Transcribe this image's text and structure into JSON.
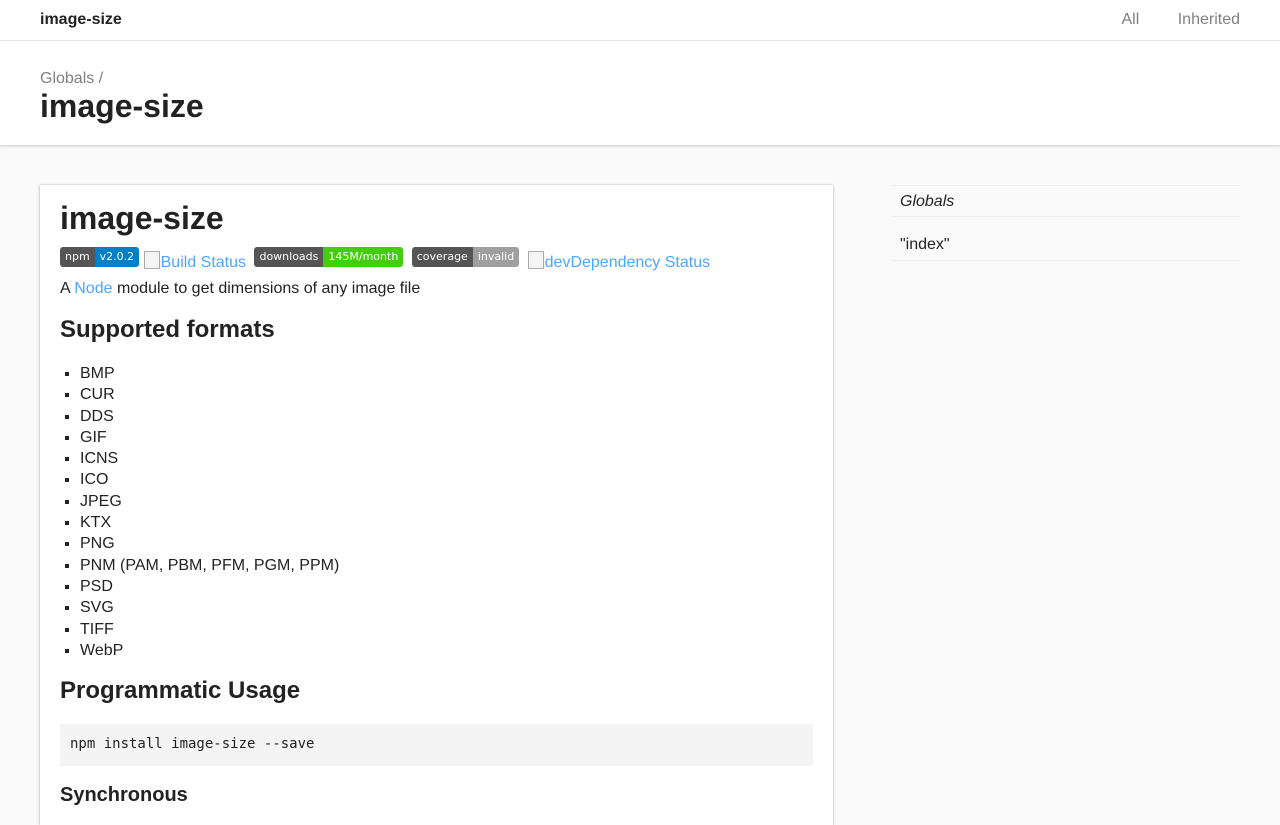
{
  "toolbar": {
    "site_title": "image-size",
    "links": [
      "All",
      "Inherited"
    ]
  },
  "header": {
    "breadcrumb": "Globals /",
    "title": "image-size"
  },
  "main": {
    "heading": "image-size",
    "badges": [
      {
        "left": "npm",
        "right": "v2.0.2",
        "color": "#007ec6"
      },
      {
        "left": "downloads",
        "right": "145M/month",
        "color": "#4c1"
      },
      {
        "left": "coverage",
        "right": "invalid",
        "color": "#9f9f9f"
      }
    ],
    "broken_images": [
      "Build Status",
      "devDependency Status"
    ],
    "desc_prefix": "A",
    "desc_link": "Node",
    "desc_suffix": "module to get dimensions of any image file",
    "supported_heading": "Supported formats",
    "formats": [
      "BMP",
      "CUR",
      "DDS",
      "GIF",
      "ICNS",
      "ICO",
      "JPEG",
      "KTX",
      "PNG",
      "PNM (PAM, PBM, PFM, PGM, PPM)",
      "PSD",
      "SVG",
      "TIFF",
      "WebP"
    ],
    "usage_heading": "Programmatic Usage",
    "install_cmd": "npm install image-size --save",
    "sync_heading": "Synchronous"
  },
  "sidebar": {
    "items": [
      "Globals",
      "\"index\""
    ]
  },
  "colors": {
    "link": "#4da6ff",
    "badge_label_bg": "#555555"
  }
}
